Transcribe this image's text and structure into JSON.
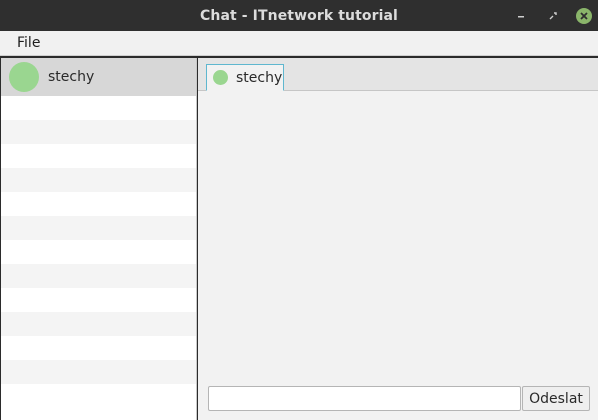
{
  "window": {
    "title": "Chat - ITnetwork tutorial",
    "controls": [
      "minimize-icon",
      "restore-icon",
      "close-icon"
    ]
  },
  "menubar": {
    "items": [
      {
        "label": "File"
      }
    ]
  },
  "users": {
    "selected": {
      "name": "stechy",
      "avatar_color": "#9ad690"
    },
    "rows_visible": 13
  },
  "chat": {
    "tabs": [
      {
        "label": "stechy",
        "avatar_color": "#9ad690",
        "active": true
      }
    ],
    "message_input": {
      "value": "",
      "placeholder": ""
    },
    "send_label": "Odeslat"
  },
  "colors": {
    "titlebar": "#2f2f2f",
    "close_button": "#8ab56a",
    "selection": "#d7d7d7",
    "tab_border": "#5fb7cf"
  }
}
